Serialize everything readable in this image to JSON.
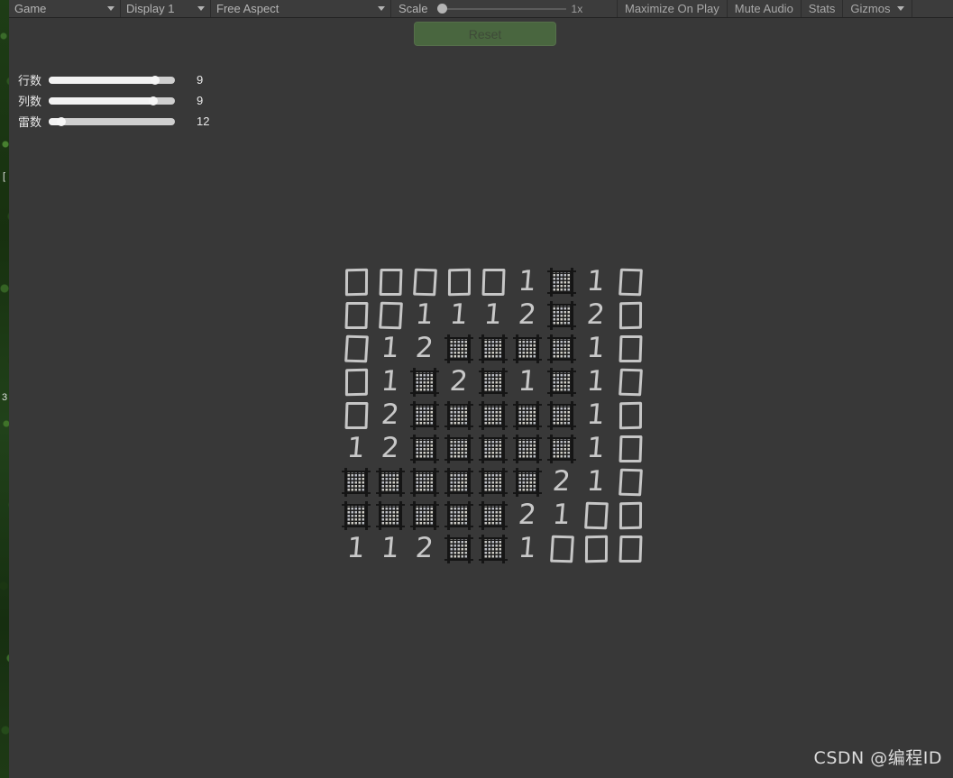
{
  "toolbar": {
    "view_selector": "Game",
    "display_selector": "Display 1",
    "aspect_selector": "Free Aspect",
    "scale_label": "Scale",
    "scale_value": "1x",
    "maximize_on_play": "Maximize On Play",
    "mute_audio": "Mute Audio",
    "stats": "Stats",
    "gizmos": "Gizmos"
  },
  "game": {
    "reset_label": "Reset",
    "sliders": [
      {
        "label": "行数",
        "value": "9",
        "fill_percent": 84
      },
      {
        "label": "列数",
        "value": "9",
        "fill_percent": 83
      },
      {
        "label": "雷数",
        "value": "12",
        "fill_percent": 10
      }
    ],
    "board": {
      "rows": 9,
      "cols": 9,
      "legend": {
        "blank": "empty-tile",
        "mine": "mine-tile"
      },
      "cells": [
        [
          "",
          "",
          "",
          "",
          "",
          "1",
          "M",
          "1",
          ""
        ],
        [
          "",
          "",
          "1",
          "1",
          "1",
          "2",
          "M",
          "2",
          ""
        ],
        [
          "",
          "1",
          "2",
          "M",
          "M",
          "M",
          "M",
          "1",
          ""
        ],
        [
          "",
          "1",
          "M",
          "2",
          "M",
          "1",
          "M",
          "1",
          ""
        ],
        [
          "",
          "2",
          "M",
          "M",
          "M",
          "M",
          "M",
          "1",
          ""
        ],
        [
          "1",
          "2",
          "M",
          "M",
          "M",
          "M",
          "M",
          "1",
          ""
        ],
        [
          "M",
          "M",
          "M",
          "M",
          "M",
          "M",
          "2",
          "1",
          ""
        ],
        [
          "M",
          "M",
          "M",
          "M",
          "M",
          "2",
          "1",
          "",
          ""
        ],
        [
          "1",
          "1",
          "2",
          "M",
          "M",
          "1",
          "",
          "",
          ""
        ]
      ]
    }
  },
  "scene_backdrop": {
    "glyph_top": "[",
    "glyph_mid": "3"
  },
  "watermark": "CSDN @编程ID",
  "colors": {
    "background": "#383838",
    "toolbar": "#3c3c3c",
    "reset_button": "#49663f",
    "text": "#c8c8c8",
    "slider_track": "#cfcfcf"
  }
}
